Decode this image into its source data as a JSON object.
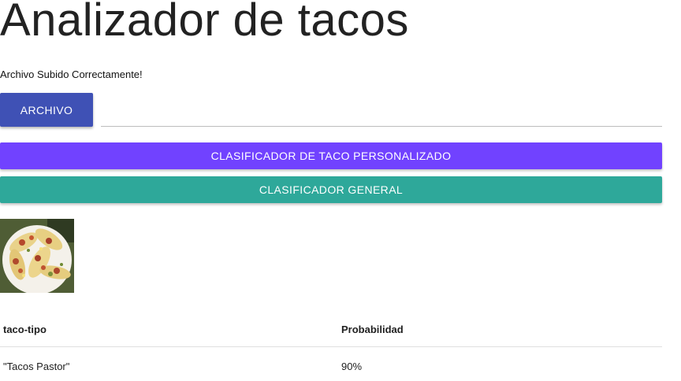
{
  "header": {
    "title": "Analizador de tacos"
  },
  "upload": {
    "status_message": "Archivo Subido Correctamente!",
    "file_button_label": "ARCHIVO",
    "file_field_value": ""
  },
  "actions": {
    "custom_classifier_label": "CLASIFICADOR DE TACO PERSONALIZADO",
    "general_classifier_label": "CLASIFICADOR GENERAL"
  },
  "preview": {
    "image_icon": "taco-photo"
  },
  "results": {
    "columns": [
      "taco-tipo",
      "Probabilidad"
    ],
    "rows": [
      {
        "type": "\"Tacos Pastor\"",
        "probability": "90%"
      }
    ]
  },
  "colors": {
    "file_button": "#3f51b5",
    "custom_button": "#7142ff",
    "general_button": "#2ea89a"
  }
}
